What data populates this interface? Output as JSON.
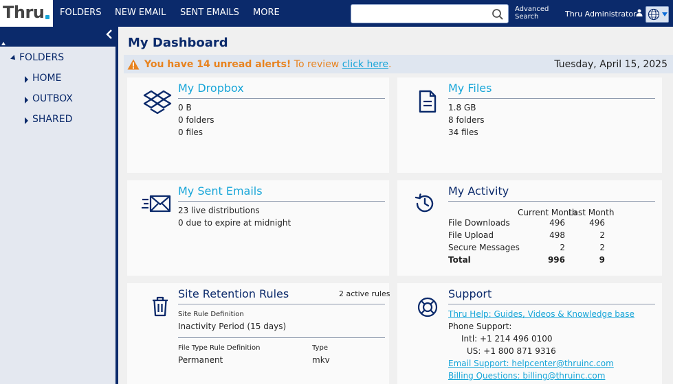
{
  "brand": {
    "logo_text": "Thru"
  },
  "nav": {
    "items": [
      "FOLDERS",
      "NEW EMAIL",
      "SENT EMAILS",
      "MORE"
    ]
  },
  "search": {
    "placeholder": "",
    "value": "",
    "advanced_line1": "Advanced",
    "advanced_line2": "Search"
  },
  "user": {
    "name": "Thru Administrator"
  },
  "sidebar": {
    "root": "FOLDERS",
    "items": [
      "HOME",
      "OUTBOX",
      "SHARED"
    ]
  },
  "page": {
    "title": "My Dashboard"
  },
  "alert": {
    "strong": "You have 14 unread alerts!",
    "prefix": "To review",
    "link": "click here",
    "suffix": ".",
    "date": "Tuesday, April 15, 2025"
  },
  "dropbox": {
    "title": "My Dropbox",
    "size": "0 B",
    "folders": "0 folders",
    "files": "0 files"
  },
  "files": {
    "title": "My Files",
    "size": "1.8 GB",
    "folders": "8 folders",
    "files": "34 files"
  },
  "sent": {
    "title": "My Sent Emails",
    "live": "23 live distributions",
    "expire": "0 due to expire at midnight"
  },
  "activity": {
    "title": "My Activity",
    "col_current": "Current Month",
    "col_last": "Last Month",
    "rows": [
      {
        "label": "File Downloads",
        "current": "496",
        "last": "496"
      },
      {
        "label": "File Upload",
        "current": "498",
        "last": "2"
      },
      {
        "label": "Secure Messages",
        "current": "2",
        "last": "2"
      }
    ],
    "total": {
      "label": "Total",
      "current": "996",
      "last": "9"
    }
  },
  "retention": {
    "title": "Site Retention Rules",
    "count": "2 active rules",
    "site_label": "Site Rule Definition",
    "site_value": "Inactivity Period (15 days)",
    "filetype_label": "File Type Rule Definition",
    "type_label": "Type",
    "filetype_value": "Permanent",
    "type_value": "mkv"
  },
  "support": {
    "title": "Support",
    "help_link": "Thru Help: Guides, Videos & Knowledge base",
    "phone_label": "Phone Support:",
    "intl": "Intl: +1 214 496 0100",
    "us": "US: +1 800 871 9316",
    "email": "Email Support: helpcenter@thruinc.com",
    "billing": "Billing Questions: billing@thruinc.com"
  },
  "colors": {
    "navy": "#0b2a6b",
    "accent": "#17a5d8",
    "alert": "#e8831f"
  }
}
